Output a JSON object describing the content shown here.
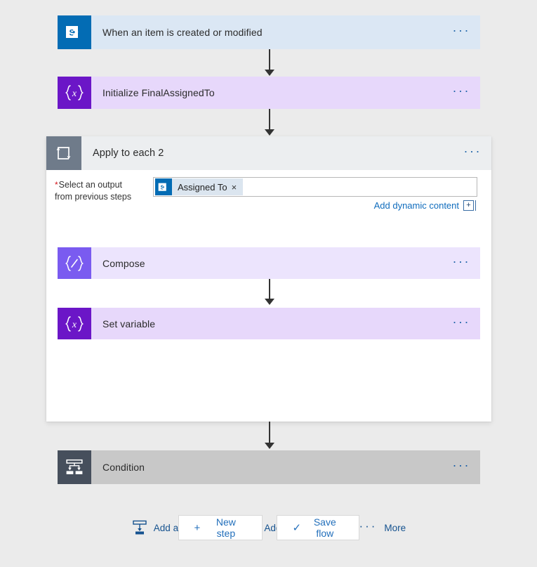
{
  "flow": {
    "trigger": {
      "title": "When an item is created or modified",
      "icon": "sharepoint-icon",
      "menu_label": "···",
      "icon_color": "#036cb4",
      "body_color": "#dbe7f4"
    },
    "initialize_variable": {
      "title": "Initialize FinalAssignedTo",
      "icon": "variable-icon",
      "icon_glyph": "{x}",
      "menu_label": "···",
      "icon_color": "#6b16c7",
      "body_color": "#e7d8fb"
    },
    "scope": {
      "title": "Apply to each 2",
      "icon": "loop-icon",
      "menu_label": "···",
      "icon_color": "#6f7b8a",
      "body_color": "#eceef0",
      "parameter": {
        "required_marker": "*",
        "label_line1": "Select an output",
        "label_line2": "from previous steps",
        "token": {
          "label": "Assigned To",
          "icon": "sharepoint-icon",
          "remove_label": "×"
        },
        "dynamic_content_link": "Add dynamic content",
        "dynamic_content_plus": "+"
      },
      "children": [
        {
          "title": "Compose",
          "icon": "compose-icon",
          "icon_glyph": "{∕}",
          "menu_label": "···",
          "icon_color": "#7a5bf0",
          "body_color": "#ece4fd"
        },
        {
          "title": "Set variable",
          "icon": "variable-icon",
          "icon_glyph": "{x}",
          "menu_label": "···",
          "icon_color": "#6b16c7",
          "body_color": "#e7d8fb"
        }
      ],
      "actions": [
        {
          "label": "Add an action",
          "icon": "add-action-icon"
        },
        {
          "label": "Add a condition",
          "icon": "add-condition-icon"
        },
        {
          "label": "More",
          "icon": "more-dots-icon",
          "dots": "···"
        }
      ]
    },
    "condition": {
      "title": "Condition",
      "icon": "condition-icon",
      "menu_label": "···",
      "icon_color": "#464f5c",
      "body_color": "#c8c8c8"
    }
  },
  "footer": {
    "new_step": {
      "label": "New step",
      "glyph": "+"
    },
    "save_flow": {
      "label": "Save flow",
      "glyph": "✓"
    }
  },
  "colors": {
    "canvas": "#ebebeb",
    "link": "#0f6cbd",
    "required": "#d4151b"
  }
}
